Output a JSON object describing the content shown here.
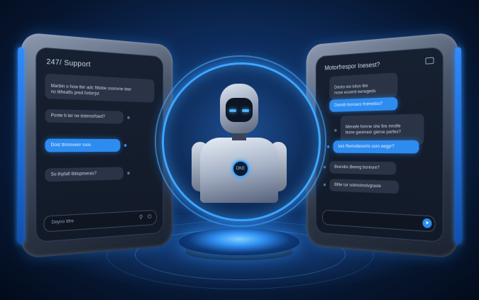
{
  "left_panel": {
    "title": "247/ Support",
    "messages": [
      {
        "text": "Marbin o how lter adc fittobe ssonvne teer\nno titheafts pred forbrrjst",
        "style": "incoming"
      },
      {
        "text": "Ponte b ter ne iistensrfoed?",
        "style": "incoming"
      },
      {
        "text": "Dost ttmnsvenr roos",
        "style": "outgoing"
      },
      {
        "text": "So thpfafl tbtispmeras?",
        "style": "incoming"
      }
    ],
    "input_placeholder": "Deyno ttfre"
  },
  "right_panel": {
    "title": "Motorfrespor Inesest?",
    "messages": [
      {
        "text": "Desto wo iotus tbe\nnoxe esserd eerwgeds",
        "style": "incoming"
      },
      {
        "text": "Donsb borcaco fromeitss?",
        "style": "outgoing"
      },
      {
        "text": "Menafe fomne she fire mrolfe\nbone garenasr gierse parfes?",
        "style": "incoming"
      },
      {
        "text": "Ioni Rernotiesorts soro eegyr?",
        "style": "outgoing"
      },
      {
        "text": "Brerobs Beeng boresre?",
        "style": "incoming"
      },
      {
        "text": "Bltte tur sotrestnolvgrasle",
        "style": "incoming"
      }
    ]
  },
  "robot": {
    "chest_label": "DKE"
  },
  "colors": {
    "accent": "#2d8cf0",
    "background": "#0d2c5c"
  }
}
